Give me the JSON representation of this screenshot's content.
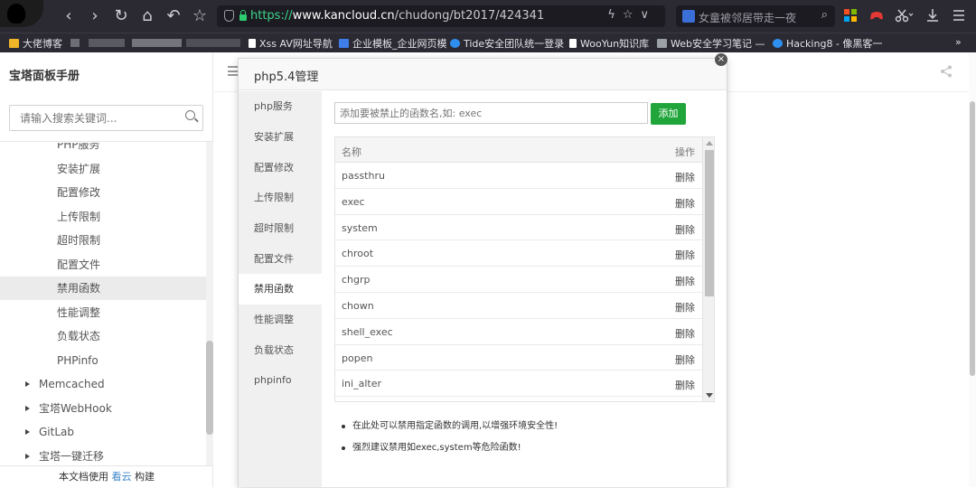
{
  "browser": {
    "url_scheme": "https://",
    "url_domain": "www.kancloud.cn",
    "url_path": "/chudong/bt2017/424341",
    "search_text": "女童被邻居带走一夜",
    "bookmarks": [
      {
        "label": "大佬博客",
        "color": "#f0b429"
      },
      {
        "label": "Xss AV网址导航",
        "color": "#ffffff"
      },
      {
        "label": "企业模板_企业网页模",
        "color": "#3f7ee8"
      },
      {
        "label": "Tide安全团队统一登录",
        "color": "#2f8ff0"
      },
      {
        "label": "WooYun知识库",
        "color": "#ffffff"
      },
      {
        "label": "Web安全学习笔记 —",
        "color": "#9aa0a6"
      },
      {
        "label": "Hacking8 - 像黑客一",
        "color": "#2f8ff0"
      }
    ],
    "overflow_label": "»"
  },
  "sidebar": {
    "title": "宝塔面板手册",
    "search_placeholder": "请输入搜索关键词...",
    "items": [
      {
        "label": "PHP服务",
        "level": "sub"
      },
      {
        "label": "安装扩展",
        "level": "sub"
      },
      {
        "label": "配置修改",
        "level": "sub"
      },
      {
        "label": "上传限制",
        "level": "sub"
      },
      {
        "label": "超时限制",
        "level": "sub"
      },
      {
        "label": "配置文件",
        "level": "sub"
      },
      {
        "label": "禁用函数",
        "level": "sub",
        "active": true
      },
      {
        "label": "性能调整",
        "level": "sub"
      },
      {
        "label": "负载状态",
        "level": "sub"
      },
      {
        "label": "PHPinfo",
        "level": "sub"
      },
      {
        "label": "Memcached",
        "level": "top"
      },
      {
        "label": "宝塔WebHook",
        "level": "top"
      },
      {
        "label": "GitLab",
        "level": "top"
      },
      {
        "label": "宝塔一键迁移",
        "level": "top"
      }
    ],
    "footer_prefix": "本文档使用",
    "footer_link": "看云",
    "footer_suffix": "构建"
  },
  "panel": {
    "title": "php5.4管理",
    "close_label": "×",
    "nav": [
      "php服务",
      "安装扩展",
      "配置修改",
      "上传限制",
      "超时限制",
      "配置文件",
      "禁用函数",
      "性能调整",
      "负载状态",
      "phpinfo"
    ],
    "active_nav": "禁用函数",
    "input_placeholder": "添加要被禁止的函数名,如: exec",
    "add_label": "添加",
    "table": {
      "headers": {
        "name": "名称",
        "op": "操作"
      },
      "rows": [
        {
          "name": "passthru",
          "op": "删除"
        },
        {
          "name": "exec",
          "op": "删除"
        },
        {
          "name": "system",
          "op": "删除"
        },
        {
          "name": "chroot",
          "op": "删除"
        },
        {
          "name": "chgrp",
          "op": "删除"
        },
        {
          "name": "chown",
          "op": "删除"
        },
        {
          "name": "shell_exec",
          "op": "删除"
        },
        {
          "name": "popen",
          "op": "删除"
        },
        {
          "name": "ini_alter",
          "op": "删除"
        }
      ]
    },
    "tips": [
      "在此处可以禁用指定函数的调用,以增强环境安全性!",
      "强烈建议禁用如exec,system等危险函数!"
    ]
  }
}
